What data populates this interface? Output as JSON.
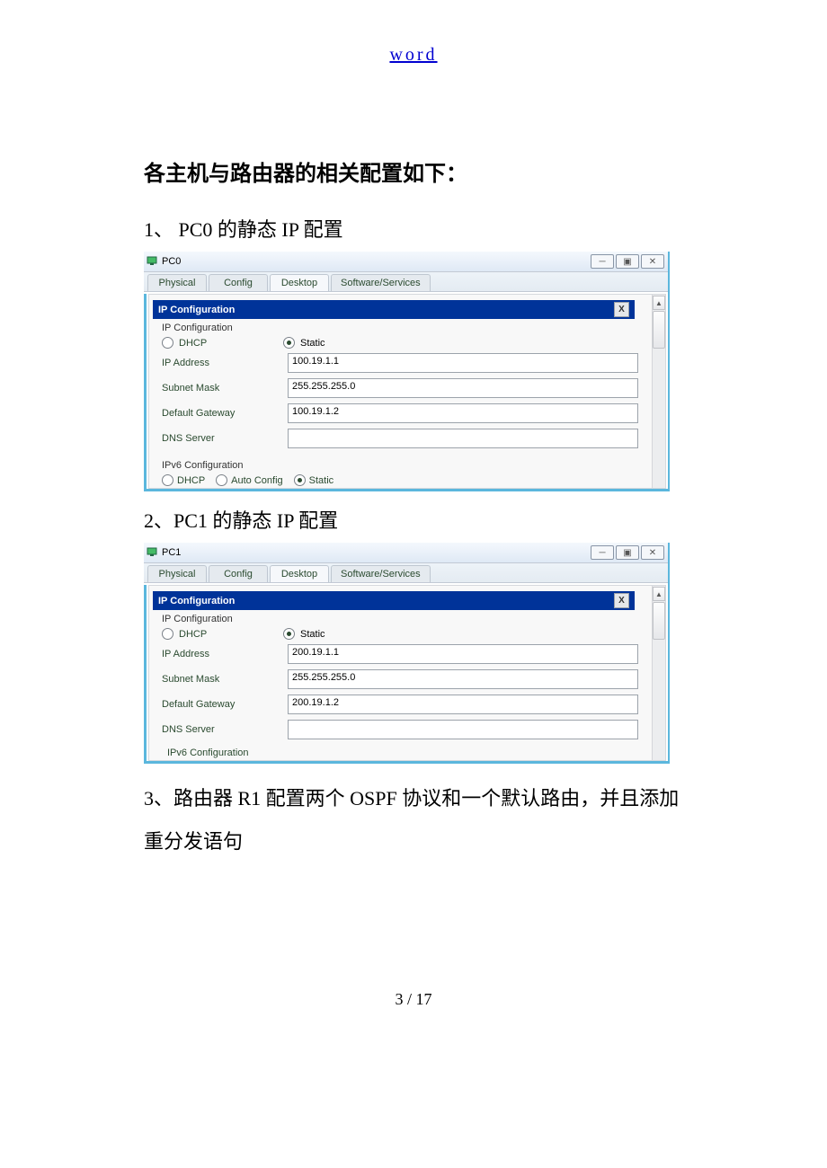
{
  "header_link": "word",
  "main_heading": "各主机与路由器的相关配置如下：",
  "section1_heading": "1、 PC0 的静态 IP 配置",
  "section2_heading": "2、PC1 的静态 IP 配置",
  "section3_heading": "3、路由器 R1 配置两个 OSPF 协议和一个默认路由，并且添加重分发语句",
  "page_num": "3 / 17",
  "pc0": {
    "title": "PC0",
    "tabs": {
      "physical": "Physical",
      "config": "Config",
      "desktop": "Desktop",
      "software": "Software/Services"
    },
    "panel_title": "IP Configuration",
    "group_label": "IP Configuration",
    "dhcp": "DHCP",
    "static": "Static",
    "ip_label": "IP Address",
    "ip_value": "100.19.1.1",
    "mask_label": "Subnet Mask",
    "mask_value": "255.255.255.0",
    "gw_label": "Default Gateway",
    "gw_value": "100.19.1.2",
    "dns_label": "DNS Server",
    "dns_value": "",
    "ipv6_label": "IPv6 Configuration",
    "ipv6_dhcp": "DHCP",
    "ipv6_auto": "Auto Config",
    "ipv6_static": "Static"
  },
  "pc1": {
    "title": "PC1",
    "tabs": {
      "physical": "Physical",
      "config": "Config",
      "desktop": "Desktop",
      "software": "Software/Services"
    },
    "panel_title": "IP Configuration",
    "group_label": "IP Configuration",
    "dhcp": "DHCP",
    "static": "Static",
    "ip_label": "IP Address",
    "ip_value": "200.19.1.1",
    "mask_label": "Subnet Mask",
    "mask_value": "255.255.255.0",
    "gw_label": "Default Gateway",
    "gw_value": "200.19.1.2",
    "dns_label": "DNS Server",
    "dns_value": "",
    "ipv6_label": "IPv6 Configuration"
  }
}
